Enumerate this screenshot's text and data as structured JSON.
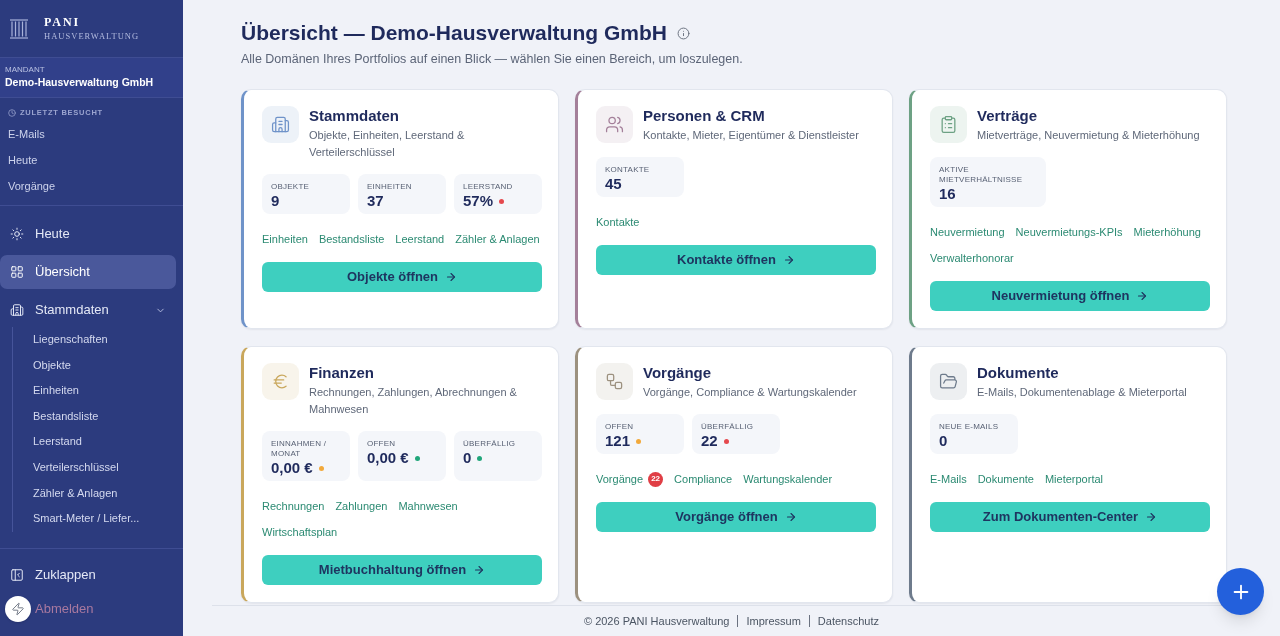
{
  "sidebar": {
    "logo": {
      "name": "PANI",
      "tagline": "HAUSVERWALTUNG"
    },
    "client": {
      "label": "MANDANT",
      "name": "Demo-Hausverwaltung GmbH"
    },
    "recent": {
      "title": "ZULETZT BESUCHT",
      "items": [
        "E-Mails",
        "Heute",
        "Vorgänge"
      ]
    },
    "nav": [
      {
        "label": "Heute",
        "selected": false
      },
      {
        "label": "Übersicht",
        "selected": true
      },
      {
        "label": "Stammdaten",
        "selected": false,
        "expanded": true,
        "children": [
          {
            "label": "Liegenschaften",
            "selected": false
          },
          {
            "label": "Objekte",
            "selected": false
          },
          {
            "label": "Einheiten",
            "selected": false
          },
          {
            "label": "Bestandsliste",
            "selected": false
          },
          {
            "label": "Leerstand",
            "selected": false
          },
          {
            "label": "Verteilerschlüssel",
            "selected": false
          },
          {
            "label": "Zähler & Anlagen",
            "selected": false
          },
          {
            "label": "Smart-Meter / Liefer...",
            "selected": false
          }
        ]
      }
    ],
    "bottom": [
      {
        "kind": "collapse",
        "label": "Zuklappen"
      },
      {
        "kind": "logout",
        "label": "Abmelden"
      }
    ]
  },
  "page": {
    "title": "Übersicht — Demo-Hausverwaltung GmbH",
    "subtitle": "Alle Domänen Ihres Portfolios auf einen Blick — wählen Sie einen Bereich, um loszulegen."
  },
  "cards": [
    {
      "title": "Stammdaten",
      "description": "Objekte, Einheiten, Leerstand & Verteilerschlüssel",
      "color": "#6f93c9",
      "stats": [
        {
          "label": "OBJEKTE",
          "value": "9"
        },
        {
          "label": "EINHEITEN",
          "value": "37"
        },
        {
          "label": "LEERSTAND",
          "value": "57%",
          "color": "#e5484d"
        }
      ],
      "links": [
        {
          "label": "Einheiten"
        },
        {
          "label": "Bestandsliste"
        },
        {
          "label": "Leerstand"
        },
        {
          "label": "Zähler & Anlagen"
        }
      ],
      "button": "Objekte öffnen"
    },
    {
      "title": "Personen & CRM",
      "description": "Kontakte, Mieter, Eigentümer & Dienstleister",
      "color": "#a4809a",
      "stats": [
        {
          "label": "KONTAKTE",
          "value": "45"
        }
      ],
      "links": [
        {
          "label": "Kontakte"
        }
      ],
      "button": "Kontakte öffnen"
    },
    {
      "title": "Verträge",
      "description": "Mietverträge, Neuvermietung & Mieterhöhung",
      "color": "#6da184",
      "stats": [
        {
          "label": "AKTIVE MIETVERHÄLTNISSE",
          "value": "16"
        }
      ],
      "links": [
        {
          "label": "Neuvermietung"
        },
        {
          "label": "Neuvermietungs-KPIs"
        },
        {
          "label": "Mieterhöhung"
        },
        {
          "label": "Verwalterhonorar"
        }
      ],
      "button": "Neuvermietung öffnen"
    },
    {
      "title": "Finanzen",
      "description": "Rechnungen, Zahlungen, Abrechnungen & Mahnwesen",
      "color": "#c9a75c",
      "stats": [
        {
          "label": "EINNAHMEN / MONAT",
          "value": "0,00 €",
          "color": "#f2a93b"
        },
        {
          "label": "OFFEN",
          "value": "0,00 €",
          "color": "#20a67a"
        },
        {
          "label": "ÜBERFÄLLIG",
          "value": "0",
          "color": "#20a67a"
        }
      ],
      "links": [
        {
          "label": "Rechnungen"
        },
        {
          "label": "Zahlungen"
        },
        {
          "label": "Mahnwesen"
        },
        {
          "label": "Wirtschaftsplan"
        }
      ],
      "button": "Mietbuchhaltung öffnen"
    },
    {
      "title": "Vorgänge",
      "description": "Vorgänge, Compliance & Wartungskalender",
      "color": "#9c917f",
      "stats": [
        {
          "label": "OFFEN",
          "value": "121",
          "color": "#f2a93b"
        },
        {
          "label": "ÜBERFÄLLIG",
          "value": "22",
          "color": "#e5484d"
        }
      ],
      "links": [
        {
          "label": "Vorgänge",
          "badge": "22"
        },
        {
          "label": "Compliance"
        },
        {
          "label": "Wartungskalender"
        }
      ],
      "button": "Vorgänge öffnen"
    },
    {
      "title": "Dokumente",
      "description": "E-Mails, Dokumentenablage & Mieterportal",
      "color": "#6e7b8c",
      "stats": [
        {
          "label": "NEUE E-MAILS",
          "value": "0"
        }
      ],
      "links": [
        {
          "label": "E-Mails"
        },
        {
          "label": "Dokumente"
        },
        {
          "label": "Mieterportal"
        }
      ],
      "button": "Zum Dokumenten-Center"
    }
  ],
  "footer": {
    "copyright": "© 2026 PANI Hausverwaltung",
    "links": [
      "Impressum",
      "Datenschutz"
    ]
  }
}
